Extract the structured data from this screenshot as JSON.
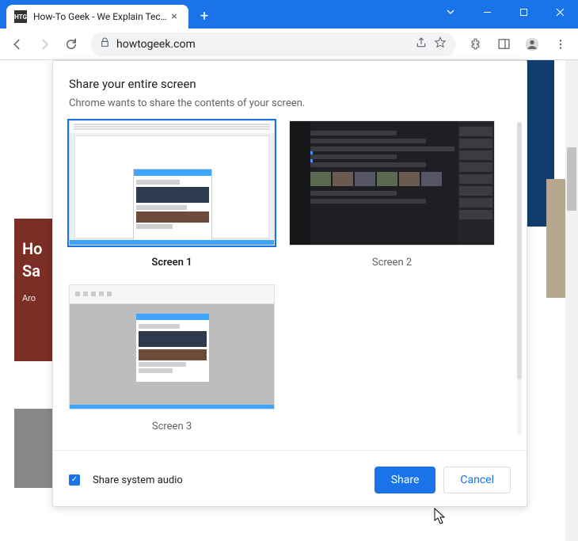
{
  "titlebar": {
    "tab_title": "How-To Geek - We Explain Techn",
    "favicon_text": "HTG"
  },
  "toolbar": {
    "url": "howtogeek.com"
  },
  "page": {
    "hero_line1": "Ho",
    "hero_line2": "Sa",
    "hero_sub": "Aro"
  },
  "dialog": {
    "title": "Share your entire screen",
    "subtitle": "Chrome wants to share the contents of your screen.",
    "screens": [
      {
        "label": "Screen 1",
        "selected": true
      },
      {
        "label": "Screen 2",
        "selected": false
      },
      {
        "label": "Screen 3",
        "selected": false
      }
    ],
    "audio_label": "Share system audio",
    "audio_checked": true,
    "share_label": "Share",
    "cancel_label": "Cancel"
  }
}
